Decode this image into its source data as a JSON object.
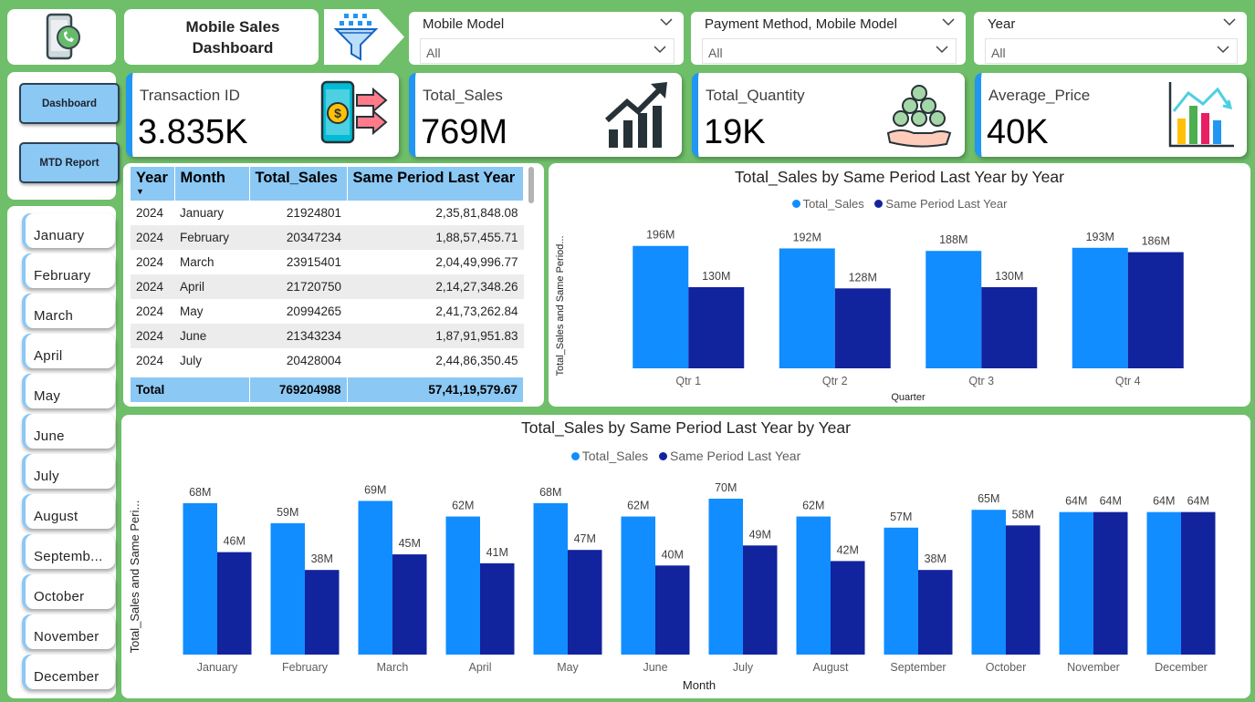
{
  "header": {
    "title": "Mobile Sales Dashboard"
  },
  "slicers": [
    {
      "label": "Mobile Model",
      "value": "All"
    },
    {
      "label": "Payment Method, Mobile Model",
      "value": "All"
    },
    {
      "label": "Year",
      "value": "All"
    }
  ],
  "kpis": [
    {
      "label": "Transaction ID",
      "value": "3.835K",
      "icon": "mobile-payment-icon"
    },
    {
      "label": "Total_Sales",
      "value": "769M",
      "icon": "growth-chart-icon"
    },
    {
      "label": "Total_Quantity",
      "value": "19K",
      "icon": "coins-hand-icon"
    },
    {
      "label": "Average_Price",
      "value": "40K",
      "icon": "bar-chart-icon"
    }
  ],
  "nav": {
    "dashboard": "Dashboard",
    "mtd_report": "MTD Report"
  },
  "months": [
    "January",
    "February",
    "March",
    "April",
    "May",
    "June",
    "July",
    "August",
    "Septemb...",
    "October",
    "November",
    "December"
  ],
  "table": {
    "columns": [
      "Year",
      "Month",
      "Total_Sales",
      "Same Period Last Year"
    ],
    "rows": [
      [
        "2024",
        "January",
        "21924801",
        "2,35,81,848.08"
      ],
      [
        "2024",
        "February",
        "20347234",
        "1,88,57,455.71"
      ],
      [
        "2024",
        "March",
        "23915401",
        "2,04,49,996.77"
      ],
      [
        "2024",
        "April",
        "21720750",
        "2,14,27,348.26"
      ],
      [
        "2024",
        "May",
        "20994265",
        "2,41,73,262.84"
      ],
      [
        "2024",
        "June",
        "21343234",
        "1,87,91,951.83"
      ],
      [
        "2024",
        "July",
        "20428004",
        "2,44,86,350.45"
      ]
    ],
    "total": {
      "label": "Total",
      "total_sales": "769204988",
      "same_period": "57,41,19,579.67"
    }
  },
  "colors": {
    "background": "#6fbe6a",
    "total_sales": "#118dff",
    "same_period": "#12239e",
    "header": "#8cc8f4"
  },
  "chart_data": [
    {
      "type": "bar",
      "title": "Total_Sales by Same Period Last Year by Year",
      "xlabel": "Quarter",
      "ylabel": "Total_Sales and Same Period...",
      "legend": "top-center",
      "categories": [
        "Qtr 1",
        "Qtr 2",
        "Qtr 3",
        "Qtr 4"
      ],
      "series": [
        {
          "name": "Total_Sales",
          "values": [
            196,
            192,
            188,
            193
          ],
          "labels": [
            "196M",
            "192M",
            "188M",
            "193M"
          ]
        },
        {
          "name": "Same Period Last Year",
          "values": [
            130,
            128,
            130,
            186
          ],
          "labels": [
            "130M",
            "128M",
            "130M",
            "186M"
          ]
        }
      ],
      "ylim": [
        0,
        200
      ]
    },
    {
      "type": "bar",
      "title": "Total_Sales by Same Period Last Year by Year",
      "xlabel": "Month",
      "ylabel": "Total_Sales and Same Peri...",
      "legend": "top-center",
      "categories": [
        "January",
        "February",
        "March",
        "April",
        "May",
        "June",
        "July",
        "August",
        "September",
        "October",
        "November",
        "December"
      ],
      "series": [
        {
          "name": "Total_Sales",
          "values": [
            68,
            59,
            69,
            62,
            68,
            62,
            70,
            62,
            57,
            65,
            64,
            64
          ],
          "labels": [
            "68M",
            "59M",
            "69M",
            "62M",
            "68M",
            "62M",
            "70M",
            "62M",
            "57M",
            "65M",
            "64M",
            "64M"
          ]
        },
        {
          "name": "Same Period Last Year",
          "values": [
            46,
            38,
            45,
            41,
            47,
            40,
            49,
            42,
            38,
            58,
            64,
            64
          ],
          "labels": [
            "46M",
            "38M",
            "45M",
            "41M",
            "47M",
            "40M",
            "49M",
            "42M",
            "38M",
            "58M",
            "64M",
            "64M"
          ]
        }
      ],
      "ylim": [
        0,
        70
      ]
    }
  ]
}
